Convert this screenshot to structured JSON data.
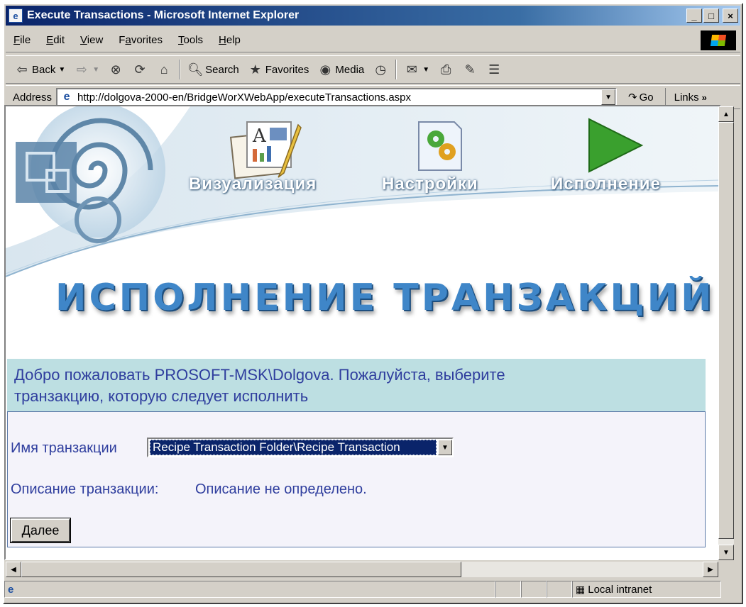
{
  "window": {
    "title": "Execute Transactions - Microsoft Internet Explorer",
    "caption_buttons": [
      "_",
      "□",
      "×"
    ]
  },
  "menu": [
    {
      "label": "File",
      "key": "F",
      "rest": "ile"
    },
    {
      "label": "Edit",
      "key": "E",
      "rest": "dit"
    },
    {
      "label": "View",
      "key": "V",
      "rest": "iew"
    },
    {
      "label": "Favorites",
      "key": "a",
      "pre": "F",
      "rest": "vorites"
    },
    {
      "label": "Tools",
      "key": "T",
      "rest": "ools"
    },
    {
      "label": "Help",
      "key": "H",
      "rest": "elp"
    }
  ],
  "toolbar": {
    "back": "Back",
    "search": "Search",
    "favorites": "Favorites",
    "media": "Media"
  },
  "address": {
    "label": "Address",
    "url": "http://dolgova-2000-en/BridgeWorXWebApp/executeTransactions.aspx",
    "go": "Go",
    "links": "Links"
  },
  "page": {
    "nav": {
      "visualization": "Визуализация",
      "settings": "Настройки",
      "execution": "Исполнение"
    },
    "banner_title": "ИСПОЛНЕНИЕ ТРАНЗАКЦИЙ",
    "welcome_line1": "Добро пожаловать PROSOFT-MSK\\Dolgova. Пожалуйста, выберите",
    "welcome_line2": "транзакцию, которую следует исполнить",
    "transaction_name_label": "Имя транзакции",
    "transaction_selected": "Recipe Transaction Folder\\Recipe Transaction",
    "description_label": "Описание транзакции:",
    "description_value": "Описание не определено.",
    "next_button": "Далее"
  },
  "status": {
    "zone": "Local intranet"
  },
  "icons": {
    "title": "ie-logo-icon",
    "back": "back-arrow-icon",
    "forward": "forward-arrow-icon",
    "stop": "stop-icon",
    "refresh": "refresh-icon",
    "home": "home-icon",
    "search": "search-icon",
    "favorites": "favorites-icon",
    "media": "media-icon",
    "history": "history-icon",
    "mail": "mail-icon",
    "print": "print-icon",
    "edit": "edit-icon",
    "discuss": "discuss-icon"
  },
  "colors": {
    "title_start": "#0a246a",
    "welcome_bg": "#bddfe2",
    "text_blue": "#2f3e9e",
    "banner_blue": "#3f86c8",
    "execute_green": "#3aa02e"
  }
}
